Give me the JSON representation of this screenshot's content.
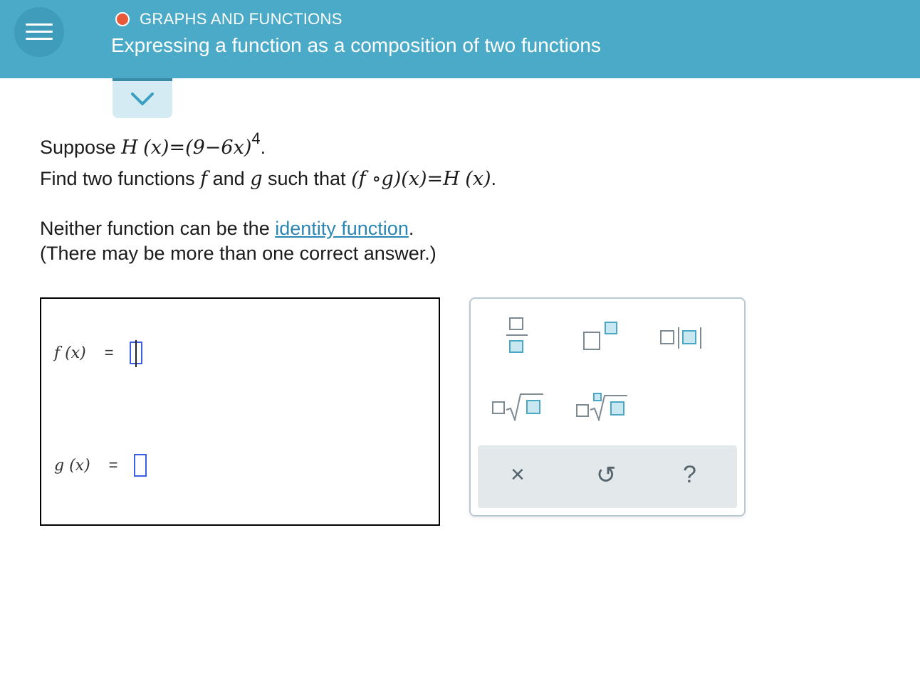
{
  "header": {
    "topic": "GRAPHS AND FUNCTIONS",
    "title": "Expressing a function as a composition of two functions"
  },
  "question": {
    "line1_prefix": "Suppose ",
    "line1_H": "H",
    "line1_x": "(x)",
    "line1_eq": "=",
    "line1_expr": "(9−6x)",
    "line1_exp": "4",
    "line1_end": ".",
    "line2_prefix": "Find two functions ",
    "line2_f": "f",
    "line2_and": " and ",
    "line2_g": "g",
    "line2_mid": " such that ",
    "line2_comp": "(f ∘g)(x)",
    "line2_eq": "=",
    "line2_H": "H",
    "line2_Hx": "(x)",
    "line2_end": ".",
    "line3_prefix": "Neither function can be the ",
    "line3_link": "identity function",
    "line3_end": ".",
    "line4": "(There may be more than one correct answer.)"
  },
  "answer": {
    "f_label": "f (x)",
    "g_label": "g (x)",
    "equals": "="
  },
  "keypad": {
    "clear_symbol": "×",
    "undo_symbol": "↺",
    "help_symbol": "?"
  },
  "colors": {
    "header_bg": "#4aaac8",
    "topic_dot": "#e8593a",
    "link": "#2a86b5",
    "slot_border": "#3c5ee6"
  }
}
